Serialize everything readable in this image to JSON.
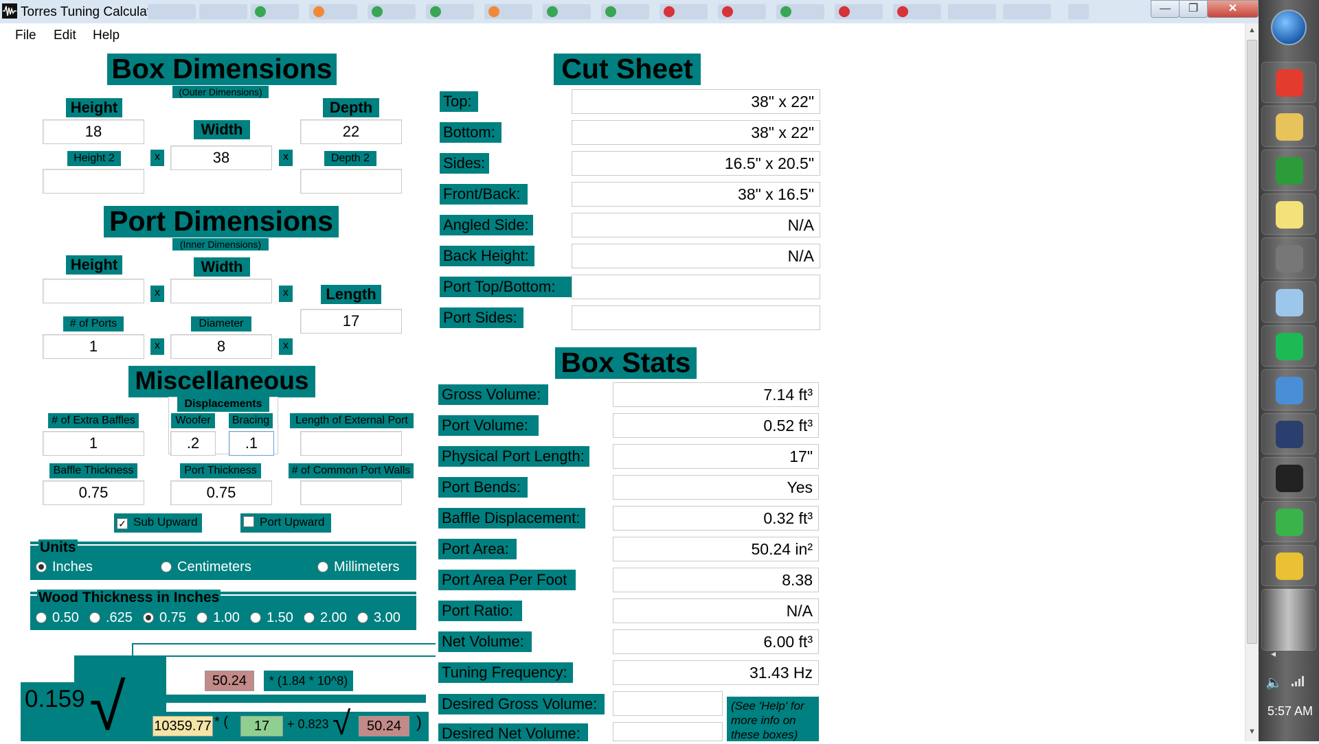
{
  "window": {
    "title": "Torres Tuning Calculator",
    "min": "—",
    "restore": "❐",
    "close": "✕"
  },
  "menu": [
    "File",
    "Edit",
    "Help"
  ],
  "box_dimensions": {
    "title": "Box Dimensions",
    "subtitle": "(Outer Dimensions)",
    "height_label": "Height",
    "height": "18",
    "width_label": "Width",
    "width": "38",
    "depth_label": "Depth",
    "depth": "22",
    "height2_label": "Height 2",
    "height2": "",
    "depth2_label": "Depth 2",
    "depth2": "",
    "x": "x"
  },
  "port_dimensions": {
    "title": "Port Dimensions",
    "subtitle": "(Inner Dimensions)",
    "height_label": "Height",
    "height": "",
    "width_label": "Width",
    "width": "",
    "length_label": "Length",
    "length": "17",
    "ports_label": "# of Ports",
    "ports": "1",
    "diameter_label": "Diameter",
    "diameter": "8"
  },
  "misc": {
    "title": "Miscellaneous",
    "displacements": "Displacements",
    "extra_baffles_label": "# of Extra Baffles",
    "extra_baffles": "1",
    "woofer_label": "Woofer",
    "woofer": ".2",
    "bracing_label": "Bracing",
    "bracing": ".1",
    "ext_port_label": "Length of External Port",
    "ext_port": "",
    "baffle_thick_label": "Baffle Thickness",
    "baffle_thick": "0.75",
    "port_thick_label": "Port Thickness",
    "port_thick": "0.75",
    "common_walls_label": "# of Common Port Walls",
    "common_walls": "",
    "sub_upward": "Sub Upward",
    "port_upward": "Port Upward",
    "check": "✓"
  },
  "units": {
    "title": "Units",
    "options": [
      "Inches",
      "Centimeters",
      "Millimeters"
    ],
    "selected": "Inches"
  },
  "wood": {
    "title": "Wood Thickness in Inches",
    "options": [
      "0.50",
      ".625",
      "0.75",
      "1.00",
      "1.50",
      "2.00",
      "3.00"
    ],
    "selected": "0.75"
  },
  "formula": {
    "coef": "0.159",
    "sqrt": "√",
    "area_top": "50.24",
    "multiplier": "* (1.84 * 10^8)",
    "vol": "10359.77",
    "times_open": "* (",
    "length": "17",
    "plus": "+ 0.823",
    "area_bottom": "50.24",
    "close": ")"
  },
  "cut_sheet": {
    "title": "Cut Sheet",
    "rows": [
      {
        "label": "Top:",
        "value": "38\" x 22\""
      },
      {
        "label": "Bottom:",
        "value": "38\" x 22\""
      },
      {
        "label": "Sides:",
        "value": "16.5\" x 20.5\""
      },
      {
        "label": "Front/Back:",
        "value": "38\" x 16.5\""
      },
      {
        "label": "Angled Side:",
        "value": "N/A"
      },
      {
        "label": "Back Height:",
        "value": "N/A"
      },
      {
        "label": "Port Top/Bottom:",
        "value": ""
      },
      {
        "label": "Port Sides:",
        "value": ""
      }
    ]
  },
  "box_stats": {
    "title": "Box Stats",
    "rows": [
      {
        "label": "Gross Volume:",
        "value": "7.14 ft³"
      },
      {
        "label": "Port Volume:",
        "value": "0.52 ft³"
      },
      {
        "label": "Physical Port Length:",
        "value": "17\""
      },
      {
        "label": "Port Bends:",
        "value": "Yes"
      },
      {
        "label": "Baffle Displacement:",
        "value": "0.32 ft³"
      },
      {
        "label": "Port Area:",
        "value": "50.24 in²"
      },
      {
        "label": "Port Area Per Foot",
        "value": "8.38"
      },
      {
        "label": "Port Ratio:",
        "value": "N/A"
      },
      {
        "label": "Net Volume:",
        "value": "6.00 ft³"
      },
      {
        "label": "Tuning Frequency:",
        "value": "31.43 Hz"
      }
    ],
    "desired_gross_label": "Desired Gross Volume:",
    "desired_gross": "",
    "desired_net_label": "Desired Net Volume:",
    "desired_net": "",
    "help_note": "(See 'Help' for more info on these boxes)"
  },
  "taskbar": {
    "clock": "5:57 AM",
    "icons": [
      "start-orb-icon",
      "chrome-icon",
      "folder-icon",
      "pinwheel-icon",
      "sticky-notes-icon",
      "mouse-icon",
      "calculator-icon",
      "spotify-icon",
      "control-panel-icon",
      "winisd-icon",
      "waveform-icon",
      "app-r-icon",
      "disc-icon"
    ],
    "icon_colors": [
      "#2b7fd4",
      "#e33b2e",
      "#e8c25a",
      "#2c9b3a",
      "#f3e27a",
      "#777777",
      "#9cc7ea",
      "#1db954",
      "#4a8fd6",
      "#2a3f6e",
      "#222222",
      "#3ab34a",
      "#e9c132"
    ]
  }
}
